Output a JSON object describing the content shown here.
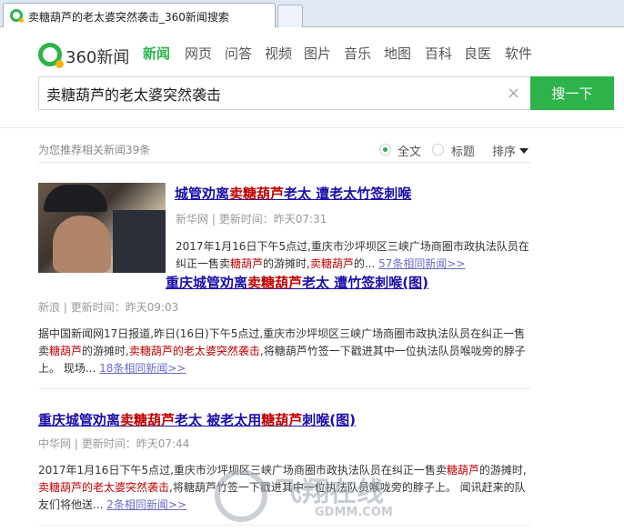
{
  "browser": {
    "tab_title": "卖糖葫芦的老太婆突然袭击_360新闻搜索"
  },
  "header": {
    "logo_text": "360新闻",
    "nav": [
      {
        "label": "新闻",
        "active": true
      },
      {
        "label": "网页"
      },
      {
        "label": "问答"
      },
      {
        "label": "视频"
      },
      {
        "label": "图片"
      },
      {
        "label": "音乐"
      },
      {
        "label": "地图"
      },
      {
        "label": "百科"
      },
      {
        "label": "良医"
      },
      {
        "label": "软件"
      }
    ],
    "search_value": "卖糖葫芦的老太婆突然袭击",
    "clear_glyph": "×",
    "search_button": "搜一下"
  },
  "filters": {
    "result_count": "为您推荐相关新闻39条",
    "fulltext_label": "全文",
    "title_label": "标题",
    "sort_label": "排序"
  },
  "results": [
    {
      "title_pre": "城管劝离",
      "title_hl": "卖糖葫芦",
      "title_post": "老太 遭老太竹签刺喉",
      "source": "新华网",
      "time": "更新时间：昨天07:31",
      "body_pre": "2017年1月16日下午5点过,重庆市沙坪坝区三峡广场商圈市政执法队员在纠正一售卖",
      "body_hl1": "糖葫芦",
      "body_mid": "的游摊时,",
      "body_hl2": "卖糖葫芦",
      "body_post": "的...",
      "more": "57条相同新闻>>"
    },
    {
      "title_pre": "重庆城管劝离",
      "title_hl": "卖糖葫芦",
      "title_post": "老太 遭竹签刺喉(图)",
      "source": "新浪",
      "time": "更新时间：昨天09:03",
      "body_pre": "据中国新闻网17日报道,昨日(16日)下午5点过,重庆市沙坪坝区三峡广场商圈市政执法队员在纠正一售卖",
      "body_hl1": "糖葫芦",
      "body_mid": "的游摊时,",
      "body_hl2": "卖糖葫芦的老太婆突然袭击",
      "body_post": ",将糖葫芦竹签一下戳进其中一位执法队员喉咙旁的脖子上。 现场...",
      "more": "18条相同新闻>>"
    },
    {
      "title_pre": "重庆城管劝离",
      "title_hl": "卖糖葫芦",
      "title_post": "老太 被老太用",
      "title_hl2": "糖葫芦",
      "title_post2": "刺喉(图)",
      "source": "中华网",
      "time": "更新时间：昨天07:44",
      "body_pre": "2017年1月16日下午5点过,重庆市沙坪坝区三峡广场商圈市政执法队员在纠正一售卖",
      "body_hl1": "糖葫芦",
      "body_mid": "的游摊时,",
      "body_hl2": "卖糖葫芦的老太婆突然袭击",
      "body_post": ",将糖葫芦竹签一下戳进其中一位执法队员喉咙旁的脖子上。 闻讯赶来的队友们将他送...",
      "more": "2条相同新闻>>"
    }
  ],
  "watermark": {
    "text": "飞翔在线",
    "sub": "GDMM.COM"
  }
}
